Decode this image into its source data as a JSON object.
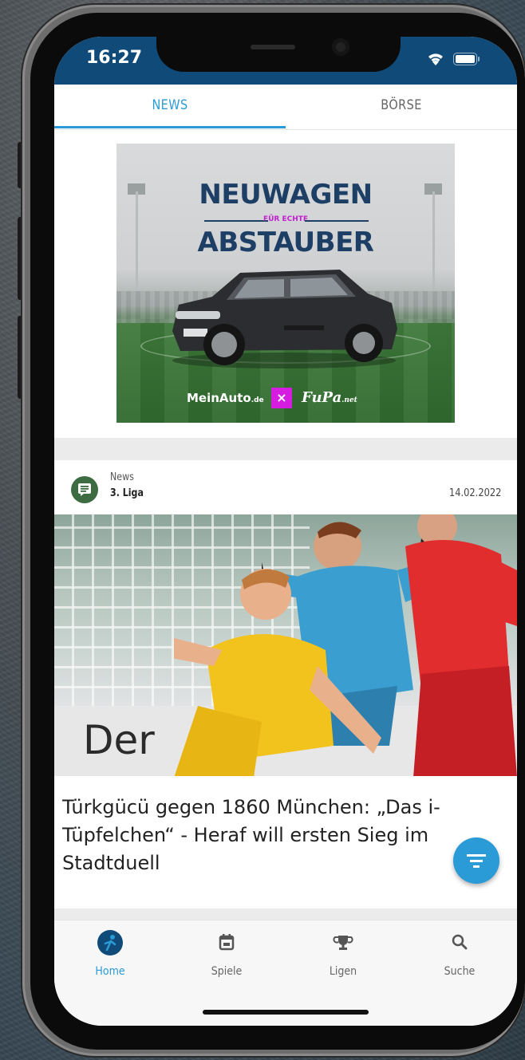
{
  "status_bar": {
    "time": "16:27"
  },
  "tabs": [
    {
      "label": "NEWS",
      "active": true
    },
    {
      "label": "BÖRSE",
      "active": false
    }
  ],
  "ad": {
    "title_line1": "NEUWAGEN",
    "subtitle": "FÜR ECHTE",
    "title_line2": "ABSTAUBER",
    "brand_left": "MeinAuto",
    "brand_left_suffix": ".de",
    "separator_symbol": "×",
    "brand_right": "FuPa",
    "brand_right_suffix": ".net"
  },
  "news_card": {
    "category": "News",
    "league": "3. Liga",
    "date": "14.02.2022",
    "photo_banner_text": "Der",
    "headline": "Türkgücü gegen 1860 München: „Das i-Tüpfelchen“ - Heraf will ersten Sieg im Stadtduell"
  },
  "fab": {
    "icon": "filter-icon"
  },
  "bottom_nav": {
    "items": [
      {
        "label": "Home",
        "icon": "home-ball-icon",
        "active": true
      },
      {
        "label": "Spiele",
        "icon": "calendar-icon",
        "active": false
      },
      {
        "label": "Ligen",
        "icon": "trophy-icon",
        "active": false
      },
      {
        "label": "Suche",
        "icon": "search-icon",
        "active": false
      }
    ]
  },
  "colors": {
    "accent": "#2a9bd6",
    "status_bar": "#0f4a78",
    "news_icon_bg": "#3d6b42",
    "ad_text": "#1d3f66",
    "ad_highlight": "#d61ce0"
  }
}
